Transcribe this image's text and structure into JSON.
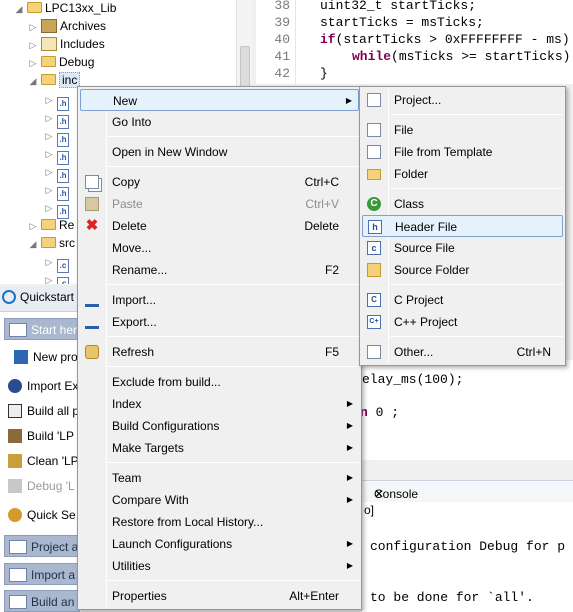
{
  "tree": {
    "project": "LPC13xx_Lib",
    "items": [
      {
        "label": "Archives"
      },
      {
        "label": "Includes"
      },
      {
        "label": "Debug"
      },
      {
        "label": "inc"
      },
      {
        "label": ".h"
      },
      {
        "label": ".h"
      },
      {
        "label": ".h"
      },
      {
        "label": ".h"
      },
      {
        "label": ".h"
      },
      {
        "label": ".h"
      },
      {
        "label": ".h"
      },
      {
        "label": "Re"
      },
      {
        "label": "src"
      },
      {
        "label": ".c"
      },
      {
        "label": ".c"
      }
    ]
  },
  "editor": {
    "lines": [
      {
        "n": "38",
        "text": "uint32_t startTicks;"
      },
      {
        "n": "39",
        "text": "startTicks = msTicks;"
      },
      {
        "n": "40",
        "kw": "if",
        "text": "(startTicks > 0xFFFFFFFF - ms)"
      },
      {
        "n": "41",
        "kw": "while",
        "text": "(msTicks >= startTicks)"
      },
      {
        "n": "42",
        "text": "}"
      }
    ],
    "lower_line1": "elay_ms(100);",
    "lower_kw": "n",
    "lower_line2": " 0 ;"
  },
  "quickstart": {
    "tab": "Quickstart",
    "items": [
      {
        "label": "Start her",
        "type": "head"
      },
      {
        "label": "New pro",
        "type": "item"
      },
      {
        "label": "Import Ex",
        "type": "item"
      },
      {
        "label": "Build all p",
        "type": "item"
      },
      {
        "label": "Build 'LP",
        "type": "item"
      },
      {
        "label": "Clean 'LP",
        "type": "item"
      },
      {
        "label": "Debug 'L",
        "type": "disabled"
      },
      {
        "label": "Quick Se",
        "type": "item"
      },
      {
        "label": "Project a",
        "type": "head"
      },
      {
        "label": "Import a",
        "type": "head"
      },
      {
        "label": "Build an",
        "type": "head"
      }
    ]
  },
  "console": {
    "tab": "Console",
    "close": "✕",
    "bracket": "o]",
    "line1": "configuration Debug for p",
    "line2": "to be done for `all'."
  },
  "context_menu": {
    "items": [
      {
        "label": "New",
        "submenu": true,
        "highlighted": true
      },
      {
        "label": "Go Into"
      },
      {
        "sep": true
      },
      {
        "label": "Open in New Window"
      },
      {
        "sep": true
      },
      {
        "label": "Copy",
        "shortcut": "Ctrl+C",
        "icon": "copy-icon"
      },
      {
        "label": "Paste",
        "shortcut": "Ctrl+V",
        "disabled": true,
        "icon": "paste-icon"
      },
      {
        "label": "Delete",
        "shortcut": "Delete",
        "icon": "delete-icon"
      },
      {
        "label": "Move..."
      },
      {
        "label": "Rename...",
        "shortcut": "F2"
      },
      {
        "sep": true
      },
      {
        "label": "Import...",
        "icon": "import-icon"
      },
      {
        "label": "Export...",
        "icon": "export-icon"
      },
      {
        "sep": true
      },
      {
        "label": "Refresh",
        "shortcut": "F5",
        "icon": "refresh-icon"
      },
      {
        "sep": true
      },
      {
        "label": "Exclude from build..."
      },
      {
        "label": "Index",
        "submenu": true
      },
      {
        "label": "Build Configurations",
        "submenu": true
      },
      {
        "label": "Make Targets",
        "submenu": true
      },
      {
        "sep": true
      },
      {
        "label": "Team",
        "submenu": true
      },
      {
        "label": "Compare With",
        "submenu": true
      },
      {
        "label": "Restore from Local History..."
      },
      {
        "label": "Launch Configurations",
        "submenu": true
      },
      {
        "label": "Utilities",
        "submenu": true
      },
      {
        "sep": true
      },
      {
        "label": "Properties",
        "shortcut": "Alt+Enter"
      }
    ]
  },
  "new_submenu": {
    "items": [
      {
        "label": "Project...",
        "icon": "new-project-icon"
      },
      {
        "sep": true
      },
      {
        "label": "File",
        "icon": "file-icon"
      },
      {
        "label": "File from Template",
        "icon": "file-template-icon"
      },
      {
        "label": "Folder",
        "icon": "folder-icon"
      },
      {
        "sep": true
      },
      {
        "label": "Class",
        "icon": "class-icon"
      },
      {
        "label": "Header File",
        "icon": "header-file-icon",
        "highlighted": true
      },
      {
        "label": "Source File",
        "icon": "source-file-icon"
      },
      {
        "label": "Source Folder",
        "icon": "source-folder-icon"
      },
      {
        "sep": true
      },
      {
        "label": "C Project",
        "icon": "c-project-icon"
      },
      {
        "label": "C++ Project",
        "icon": "cpp-project-icon"
      },
      {
        "sep": true
      },
      {
        "label": "Other...",
        "shortcut": "Ctrl+N",
        "icon": "other-icon"
      }
    ]
  },
  "glyphs": {
    "expanded": "◢",
    "collapsed": "▷",
    "submenu": "▶"
  }
}
